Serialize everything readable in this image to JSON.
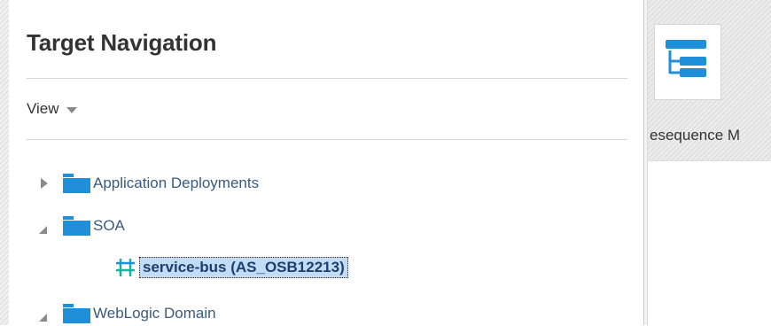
{
  "target_navigation": {
    "title": "Target Navigation",
    "view_menu": {
      "label": "View",
      "icon": "caret-down-icon"
    },
    "tree": [
      {
        "label": "Application Deployments",
        "expanded": false,
        "icon": "folder-icon"
      },
      {
        "label": "SOA",
        "expanded": true,
        "icon": "folder-icon",
        "children": [
          {
            "label": "service-bus (AS_OSB12213)",
            "selected": true,
            "icon": "service-bus-icon"
          }
        ]
      },
      {
        "label": "WebLogic Domain",
        "expanded": true,
        "icon": "folder-icon"
      }
    ]
  },
  "side_panel": {
    "tile_icon": "list-tree-icon",
    "tile_label": "esequence M"
  },
  "colors": {
    "accent_blue": "#1e8fd8",
    "link_text": "#3a5a80",
    "selection_bg": "#c3dcf5",
    "icon_teal": "#1ab0a0"
  }
}
